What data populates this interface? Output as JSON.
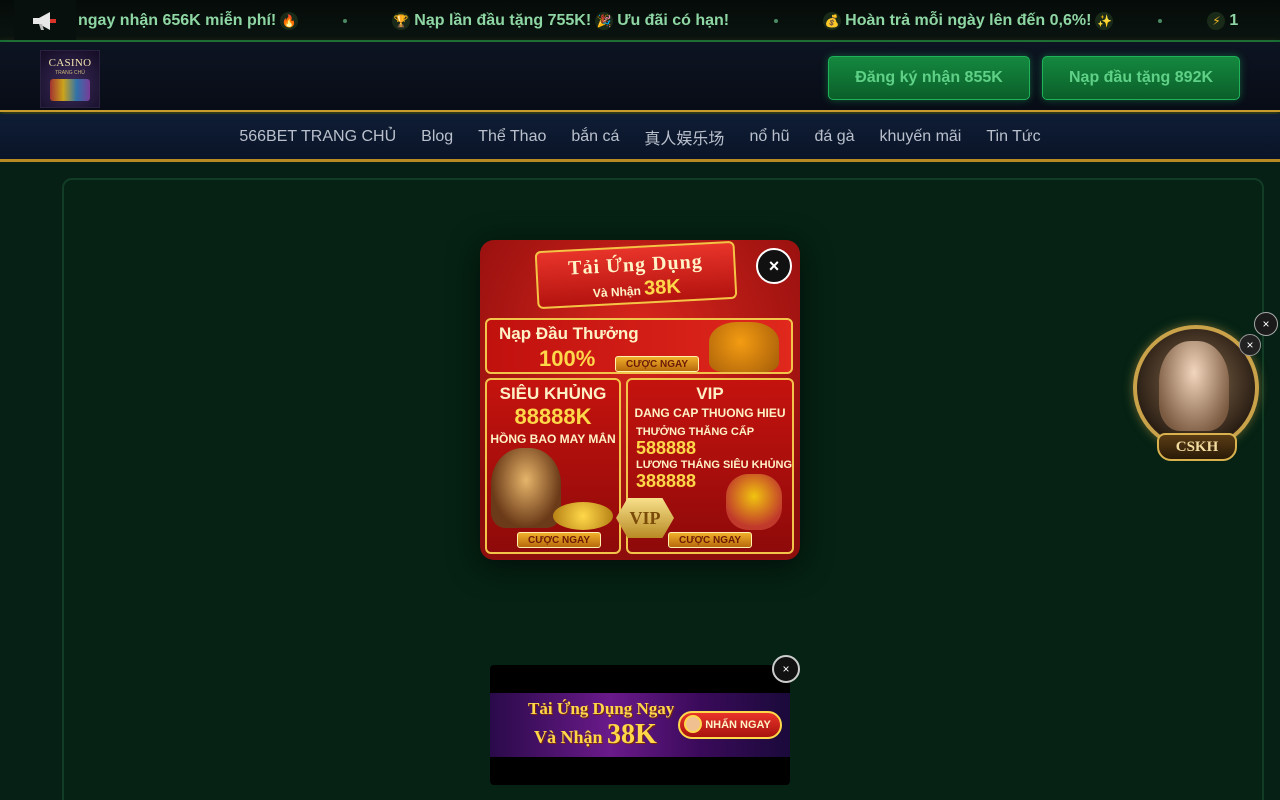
{
  "ticker": {
    "items": [
      {
        "text": "ngay nhận 656K miễn phí!",
        "emoji_after": "🔥"
      },
      {
        "emoji_before": "🏆",
        "text": "Nạp lần đầu tặng 755K!",
        "emoji_after": "🎉",
        "text2": "Ưu đãi có hạn!"
      },
      {
        "emoji_before": "💰",
        "text": "Hoàn trả mỗi ngày lên đến 0,6%!",
        "emoji_after": "✨"
      },
      {
        "emoji_before": "⚡",
        "text": "1"
      }
    ],
    "icon": "megaphone-icon"
  },
  "header": {
    "logo_text": "CASINO",
    "logo_sub": "TRANG CHỦ",
    "register_label": "Đăng ký nhận 855K",
    "deposit_label": "Nạp đầu tặng 892K"
  },
  "nav": {
    "items": [
      "566BET TRANG CHỦ",
      "Blog",
      "Thể Thao",
      "bắn cá",
      "真人娱乐场",
      "nổ hũ",
      "đá gà",
      "khuyến mãi",
      "Tin Tức"
    ]
  },
  "popup": {
    "banner_title": "Tải Ứng Dụng",
    "banner_sub_prefix": "Và Nhận",
    "banner_sub_amount": "38K",
    "deposit_title": "Nạp Đầu Thưởng",
    "deposit_pct": "100%",
    "cta": "CƯỢC NGAY",
    "left_card": {
      "title": "SIÊU KHỦNG",
      "amount": "88888K",
      "sub": "HỒNG BAO MAY MẮN"
    },
    "right_card": {
      "title": "VIP",
      "sub": "DANG CAP THUONG HIEU",
      "label1": "THƯỞNG THĂNG CẤP",
      "value1": "588888",
      "label2": "LƯƠNG THÁNG SIÊU KHỦNG",
      "value2": "388888",
      "badge": "VIP"
    },
    "close": "×"
  },
  "cskh": {
    "label": "CSKH",
    "close": "×"
  },
  "bottom_banner": {
    "title": "Tải Ứng Dụng Ngay",
    "sub_prefix": "Và Nhận",
    "sub_amount": "38K",
    "button": "NHẤN NGAY",
    "close": "×"
  }
}
